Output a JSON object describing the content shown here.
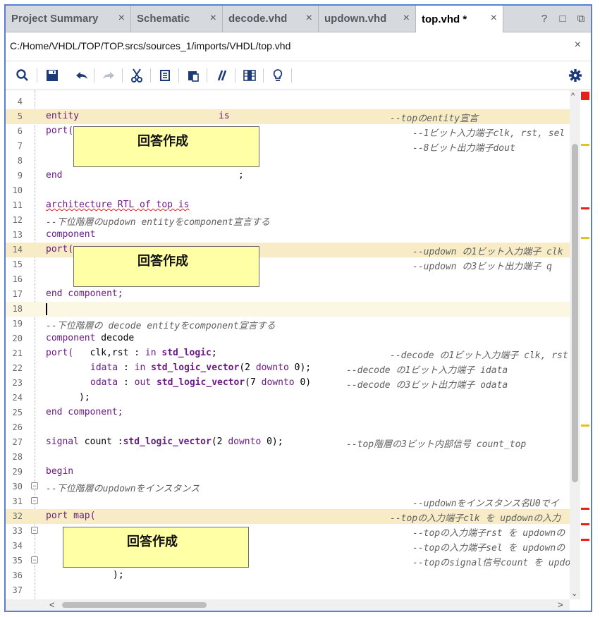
{
  "tabs": [
    {
      "label": "Project Summary",
      "close": "×"
    },
    {
      "label": "Schematic",
      "close": "×"
    },
    {
      "label": "decode.vhd",
      "close": "×"
    },
    {
      "label": "updown.vhd",
      "close": "×"
    },
    {
      "label": "top.vhd *",
      "close": "×"
    }
  ],
  "window_controls": {
    "help": "?",
    "restore": "□",
    "float": "⧉"
  },
  "file_path": "C:/Home/VHDL/TOP/TOP.srcs/sources_1/imports/VHDL/top.vhd",
  "path_close": "×",
  "toolbar_icons": [
    "search-icon",
    "save-icon",
    "undo-icon",
    "redo-icon",
    "cut-icon",
    "copy-icon",
    "paste-icon",
    "comment-icon",
    "column-select-icon",
    "bulb-icon",
    "gear-icon"
  ],
  "line_numbers": [
    "4",
    "5",
    "6",
    "7",
    "8",
    "9",
    "10",
    "11",
    "12",
    "13",
    "14",
    "15",
    "16",
    "17",
    "18",
    "19",
    "20",
    "21",
    "22",
    "23",
    "24",
    "25",
    "26",
    "27",
    "28",
    "29",
    "30",
    "31",
    "32",
    "33",
    "34",
    "35",
    "36",
    "37"
  ],
  "code": {
    "l5_entity": "entity",
    "l5_is": "is",
    "l5_comment": "--topのentity宣言",
    "l6_port": "port(",
    "l6_comment": "--1ビット入力端子clk, rst, sel",
    "l7_comment": "--8ビット出力端子dout",
    "l9_end": "end",
    "l9_semi": ";",
    "l11_arch": "architecture RTL of top is",
    "l12_comment": "--下位階層のupdown entityをcomponent宣言する",
    "l13_component": "component",
    "l14_port": "port(",
    "l14_comment": "--updown の1ビット入力端子 clk",
    "l15_comment": "--updown の3ビット出力端子 q",
    "l17_end": "end component;",
    "l19_comment": "--下位階層の decode entityをcomponent宣言する",
    "l20_component": "component",
    "l20_name": "decode",
    "l21_port": "port(",
    "l21_sigs": "clk,rst",
    "l21_colon": " : ",
    "l21_in": "in",
    "l21_type": "std_logic",
    "l21_semi": ";",
    "l21_comment": "--decode の1ビット入力端子 clk, rst",
    "l22_name": "idata",
    "l22_colon": " : ",
    "l22_in": "in",
    "l22_type": "std_logic_vector",
    "l22_open": "(2 ",
    "l22_downto": "downto",
    "l22_close": " 0);",
    "l22_comment": "--decode の1ビット入力端子 idata",
    "l23_name": "odata",
    "l23_colon": " : ",
    "l23_out": "out",
    "l23_type": "std_logic_vector",
    "l23_open": "(7 ",
    "l23_downto": "downto",
    "l23_close": " 0)",
    "l23_comment": "--decode の3ビット出力端子 odata",
    "l24_close": ");",
    "l25_end": "end component;",
    "l27_signal": "signal",
    "l27_name": " count :",
    "l27_type": "std_logic_vector",
    "l27_open": "(2 ",
    "l27_downto": "downto",
    "l27_close": " 0);",
    "l27_comment": "--top階層の3ビット内部信号 count_top",
    "l29_begin": "begin",
    "l30_comment": "--下位階層のupdownをインスタンス",
    "l31_comment": "--updownをインスタンス名U0でイ",
    "l32_portmap": "port map(",
    "l32_comment": "--topの入力端子clk を updownの入力",
    "l33_comment": "--topの入力端子rst を updownの",
    "l34_comment": "--topの入力端子sel を updownの",
    "l35_comment": "--topのsignal信号count を updo",
    "l36_close": ");"
  },
  "answer_boxes": [
    "回答作成",
    "回答作成",
    "回答作成"
  ],
  "scroll": {
    "up": "^",
    "down": "⌄",
    "left": "<",
    "right": ">"
  },
  "colors": {
    "highlight": "#f7ecc6",
    "marker_red": "#e2231a",
    "marker_yellow": "#e3c12a",
    "keyword": "#6b1a86",
    "frame": "#5b7fd0"
  }
}
